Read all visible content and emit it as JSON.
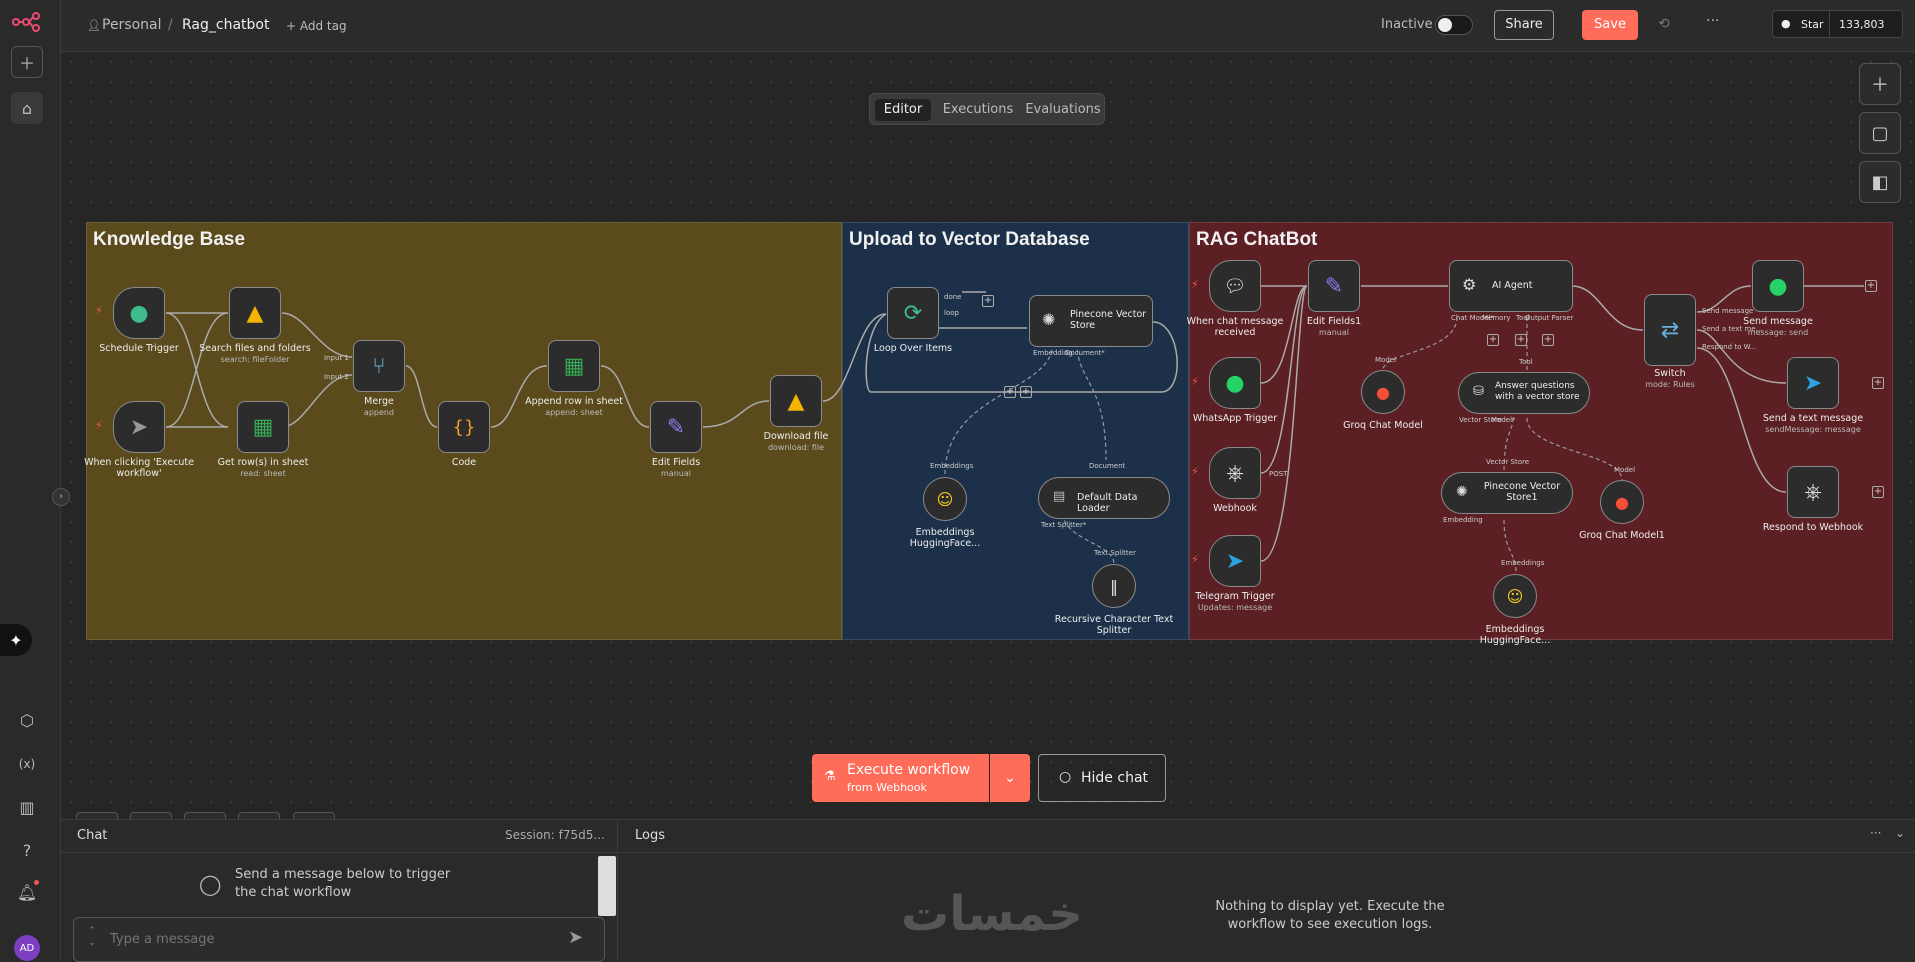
{
  "topbar": {
    "breadcrumb_owner": "Personal",
    "breadcrumb_sep": "/",
    "workflow_name": "Rag_chatbot",
    "add_tag": "+ Add tag",
    "status_label": "Inactive",
    "share_label": "Share",
    "save_label": "Save",
    "more_label": "···",
    "github_star_label": "Star",
    "github_star_count": "133,803"
  },
  "view_tabs": [
    "Editor",
    "Executions",
    "Evaluations"
  ],
  "groups": {
    "knowledge_base": "Knowledge Base",
    "upload": "Upload to Vector Database",
    "ragbot": "RAG ChatBot"
  },
  "nodes": {
    "schedule_trigger": {
      "label": "Schedule Trigger"
    },
    "manual_trigger": {
      "label": "When clicking 'Execute workflow'"
    },
    "search_files": {
      "label": "Search files and folders",
      "sub": "search: fileFolder"
    },
    "get_rows": {
      "label": "Get row(s) in sheet",
      "sub": "read: sheet"
    },
    "merge": {
      "label": "Merge",
      "sub": "append",
      "in1": "Input 1",
      "in2": "Input 2"
    },
    "code": {
      "label": "Code"
    },
    "append_row": {
      "label": "Append row in sheet",
      "sub": "append: sheet"
    },
    "edit_fields": {
      "label": "Edit Fields",
      "sub": "manual"
    },
    "download_file": {
      "label": "Download file",
      "sub": "download: file"
    },
    "loop": {
      "label": "Loop Over Items",
      "done": "done",
      "loop": "loop"
    },
    "pinecone": {
      "label": "Pinecone Vector Store",
      "port1": "Embedding",
      "port2": "Document*"
    },
    "embeddings1": {
      "label": "Embeddings HuggingFace...",
      "port": "Embeddings"
    },
    "data_loader": {
      "label": "Default Data Loader",
      "port_in": "Document",
      "port_out": "Text Splitter*"
    },
    "splitter": {
      "label": "Recursive Character Text Splitter",
      "port": "Text Splitter"
    },
    "chat_trigger": {
      "label": "When chat message received"
    },
    "whatsapp_trigger": {
      "label": "WhatsApp Trigger"
    },
    "webhook": {
      "label": "Webhook",
      "port": "POST"
    },
    "telegram_trigger": {
      "label": "Telegram Trigger",
      "sub": "Updates: message"
    },
    "edit_fields1": {
      "label": "Edit Fields1",
      "sub": "manual"
    },
    "ai_agent": {
      "label": "AI Agent",
      "p1": "Chat Model*",
      "p2": "Memory",
      "p3": "Tool",
      "p4": "Output Parser"
    },
    "groq1": {
      "label": "Groq Chat Model",
      "port": "Model"
    },
    "answer_tool": {
      "label": "Answer questions with a vector store",
      "port_in": "Tool",
      "p1": "Vector Store",
      "p2": "Model*"
    },
    "pinecone1": {
      "label": "Pinecone Vector Store1",
      "port_in": "Vector Store",
      "port_out": "Embedding"
    },
    "groq2": {
      "label": "Groq Chat Model1",
      "port": "Model"
    },
    "embeddings2": {
      "label": "Embeddings HuggingFace...",
      "port": "Embeddings"
    },
    "switch": {
      "label": "Switch",
      "sub": "mode: Rules",
      "o1": "Send message",
      "o2": "Send a text me...",
      "o3": "Respond to W..."
    },
    "send_message": {
      "label": "Send message",
      "sub": "message: send"
    },
    "send_text": {
      "label": "Send a text message",
      "sub": "sendMessage: message"
    },
    "respond_webhook": {
      "label": "Respond to Webhook"
    }
  },
  "canvas_buttons": {
    "execute_label": "Execute workflow",
    "execute_sub": "from Webhook",
    "hide_chat": "Hide chat"
  },
  "chat": {
    "title": "Chat",
    "session": "Session: f75d5...",
    "hint": "Send a message below to trigger the chat workflow",
    "placeholder": "Type a message"
  },
  "logs": {
    "title": "Logs",
    "empty": "Nothing to display yet. Execute the workflow to see execution logs.",
    "more": "···"
  },
  "user": {
    "initials": "AD"
  },
  "colors": {
    "accent": "#ff6d5a",
    "kb_group": "#5a4a1c",
    "upload_group": "#1c3149",
    "rag_group": "#5b1f24"
  }
}
